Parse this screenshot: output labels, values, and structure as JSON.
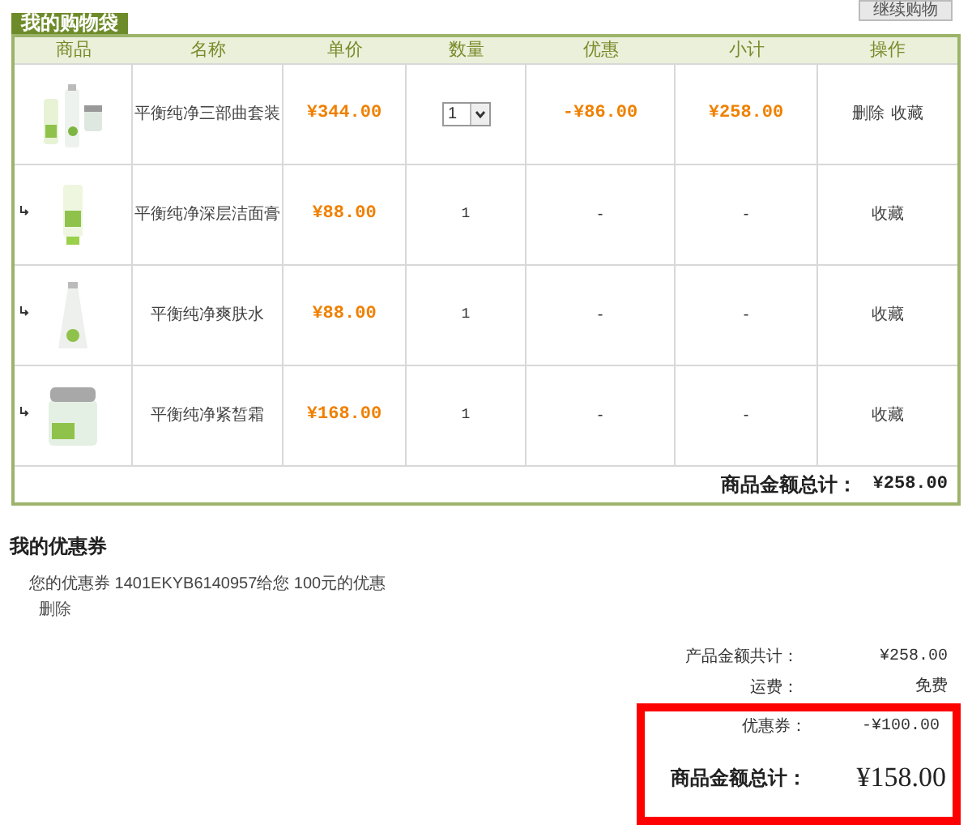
{
  "continue_button": {
    "label": "继续购物"
  },
  "cart": {
    "title": "我的购物袋",
    "columns": [
      "商品",
      "名称",
      "单价",
      "数量",
      "优惠",
      "小计",
      "操作"
    ],
    "rows": [
      {
        "kind": "bundle",
        "name": "平衡纯净三部曲套装",
        "price": "¥344.00",
        "quantity": "1",
        "discount": "-¥86.00",
        "subtotal": "¥258.00",
        "actions": [
          "删除",
          "收藏"
        ]
      },
      {
        "kind": "component",
        "name": "平衡纯净深层洁面膏",
        "price": "¥88.00",
        "quantity": "1",
        "discount": "-",
        "subtotal": "-",
        "actions": [
          "收藏"
        ]
      },
      {
        "kind": "component",
        "name": "平衡纯净爽肤水",
        "price": "¥88.00",
        "quantity": "1",
        "discount": "-",
        "subtotal": "-",
        "actions": [
          "收藏"
        ]
      },
      {
        "kind": "component",
        "name": "平衡纯净紧皙霜",
        "price": "¥168.00",
        "quantity": "1",
        "discount": "-",
        "subtotal": "-",
        "actions": [
          "收藏"
        ]
      }
    ],
    "total_label": "商品金额总计：",
    "total_value": "¥258.00"
  },
  "coupons": {
    "title": "我的优惠券",
    "text": "您的优惠券 1401EKYB6140957给您 100元的优惠",
    "delete": "删除"
  },
  "summary": [
    {
      "label": "产品金额共计：",
      "value": "¥258.00",
      "highlighted": false
    },
    {
      "label": "运费：",
      "value": "免费",
      "highlighted": false
    },
    {
      "label": "优惠券：",
      "value": "-¥100.00",
      "highlighted": true
    }
  ],
  "grand_total": {
    "label": "商品金额总计：",
    "value": "¥158.00",
    "highlighted": true
  }
}
